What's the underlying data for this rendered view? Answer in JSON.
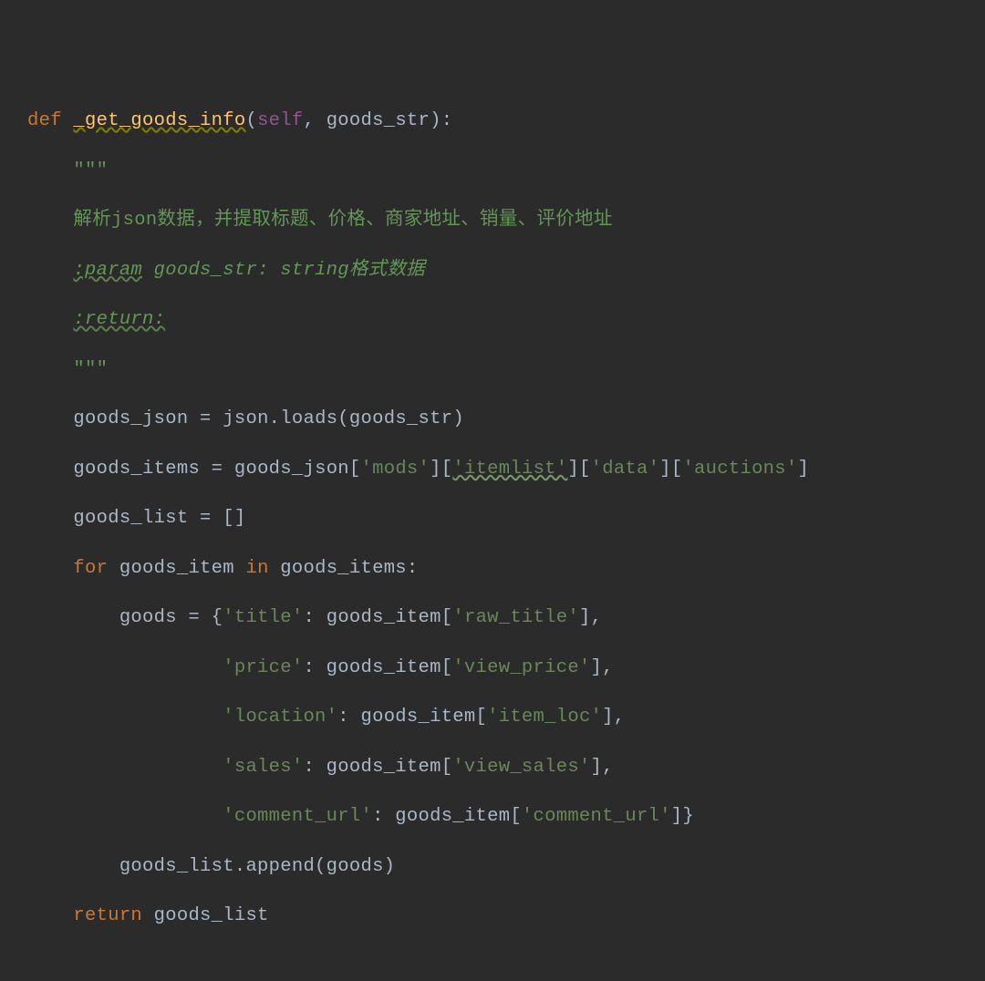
{
  "code": {
    "line1": {
      "kw_def": "def",
      "name": "_get_goods_info",
      "self": "self",
      "comma": ", ",
      "param": "goods_str",
      "close": "):"
    },
    "line2": {
      "quotes": "\"\"\""
    },
    "line3": {
      "text": "解析json数据，并提取标题、价格、商家地址、销量、评价地址"
    },
    "line4": {
      "tag": ":param",
      "rest": " goods_str: string格式数据"
    },
    "line5": {
      "tag": ":return:"
    },
    "line6": {
      "quotes": "\"\"\""
    },
    "line7": {
      "var": "goods_json ",
      "eq": "= ",
      "mod": "json.",
      "fn": "loads",
      "open": "(",
      "arg": "goods_str",
      "close": ")"
    },
    "line8": {
      "var": "goods_items ",
      "eq": "= ",
      "src": "goods_json",
      "b1o": "[",
      "k1": "'mods'",
      "b1c": "]",
      "b2o": "[",
      "k2": "'itemlist'",
      "b2c": "]",
      "b3o": "[",
      "k3": "'data'",
      "b3c": "]",
      "b4o": "[",
      "k4": "'auctions'",
      "b4c": "]"
    },
    "line9": {
      "var": "goods_list ",
      "eq": "= ",
      "val": "[]"
    },
    "line10": {
      "kw_for": "for ",
      "iter": "goods_item ",
      "kw_in": "in ",
      "seq": "goods_items:"
    },
    "line11": {
      "var": "goods ",
      "eq": "= ",
      "open": "{",
      "k": "'title'",
      "col": ": ",
      "src": "goods_item",
      "bo": "[",
      "vk": "'raw_title'",
      "bc": "]",
      "comma": ","
    },
    "line12": {
      "k": "'price'",
      "col": ": ",
      "src": "goods_item",
      "bo": "[",
      "vk": "'view_price'",
      "bc": "]",
      "comma": ","
    },
    "line13": {
      "k": "'location'",
      "col": ": ",
      "src": "goods_item",
      "bo": "[",
      "vk": "'item_loc'",
      "bc": "]",
      "comma": ","
    },
    "line14": {
      "k": "'sales'",
      "col": ": ",
      "src": "goods_item",
      "bo": "[",
      "vk": "'view_sales'",
      "bc": "]",
      "comma": ","
    },
    "line15": {
      "k": "'comment_url'",
      "col": ": ",
      "src": "goods_item",
      "bo": "[",
      "vk": "'comment_url'",
      "bc": "]",
      "close": "}"
    },
    "line16": {
      "call": "goods_list.append(goods)"
    },
    "line17": {
      "kw": "return ",
      "val": "goods_list"
    }
  }
}
